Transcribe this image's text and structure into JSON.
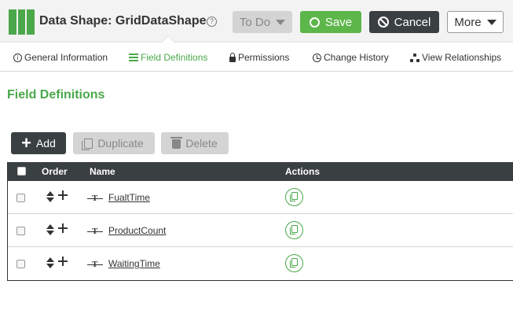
{
  "header": {
    "title": "Data Shape: GridDataShape",
    "help_glyph": "?",
    "todo_label": "To Do",
    "save_label": "Save",
    "cancel_label": "Cancel",
    "more_label": "More"
  },
  "tabs": [
    {
      "label": "General Information",
      "icon": "info-icon"
    },
    {
      "label": "Field Definitions",
      "icon": "list-icon",
      "active": true
    },
    {
      "label": "Permissions",
      "icon": "lock-icon"
    },
    {
      "label": "Change History",
      "icon": "clock-icon"
    },
    {
      "label": "View Relationships",
      "icon": "relationships-icon"
    }
  ],
  "section": {
    "title": "Field Definitions"
  },
  "actions": {
    "add_label": "Add",
    "duplicate_label": "Duplicate",
    "delete_label": "Delete"
  },
  "grid": {
    "columns": {
      "order": "Order",
      "name": "Name",
      "actions": "Actions"
    },
    "rows": [
      {
        "name": "FualtTime",
        "type_glyph": "T"
      },
      {
        "name": "ProductCount",
        "type_glyph": "T"
      },
      {
        "name": "WaitingTime",
        "type_glyph": "T"
      }
    ]
  },
  "colors": {
    "accent": "#4aa84a",
    "dark": "#3a3f42",
    "disabled": "#d4d4d4"
  }
}
